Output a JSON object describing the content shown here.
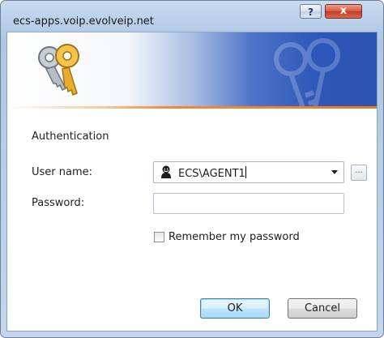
{
  "window": {
    "title": "ecs-apps.voip.evolveip.net",
    "help_label": "?",
    "close_label": "x"
  },
  "banner": {
    "icon": "keys-icon"
  },
  "form": {
    "section_title": "Authentication",
    "username_label": "User name:",
    "username_value": "ECS\\AGENT1",
    "username_icon": "user-icon",
    "browse_label": "...",
    "password_label": "Password:",
    "password_value": "",
    "remember_label": "Remember my password",
    "remember_checked": false
  },
  "buttons": {
    "ok_label": "OK",
    "cancel_label": "Cancel"
  },
  "colors": {
    "banner_blue": "#2d57b8",
    "banner_orange": "#ec7a28",
    "close_red": "#c43a22"
  }
}
